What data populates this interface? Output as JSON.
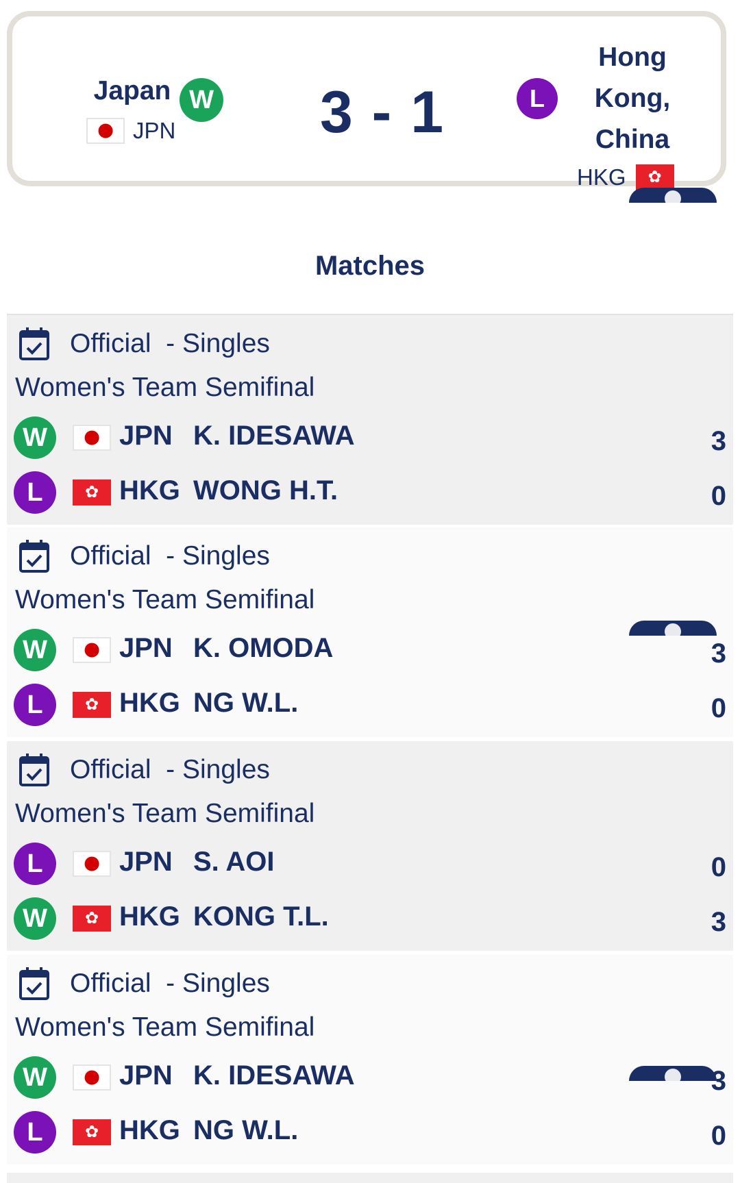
{
  "header": {
    "team_left": {
      "name": "Japan",
      "code": "JPN",
      "result": "W",
      "flag": "jpn"
    },
    "score": "3 - 1",
    "team_right": {
      "name_lines": [
        "Hong",
        "Kong,",
        "China"
      ],
      "code": "HKG",
      "result": "L",
      "flag": "hkg"
    }
  },
  "section_title": "Matches",
  "matches": [
    {
      "status": "Official",
      "type": "- Singles",
      "round": "Women's Team Semifinal",
      "players": [
        {
          "result": "W",
          "code": "JPN",
          "name": "K. IDESAWA",
          "score": "3"
        },
        {
          "result": "L",
          "code": "HKG",
          "name": "WONG H.T.",
          "score": "0"
        }
      ]
    },
    {
      "status": "Official",
      "type": "- Singles",
      "round": "Women's Team Semifinal",
      "players": [
        {
          "result": "W",
          "code": "JPN",
          "name": "K. OMODA",
          "score": "3"
        },
        {
          "result": "L",
          "code": "HKG",
          "name": "NG W.L.",
          "score": "0"
        }
      ]
    },
    {
      "status": "Official",
      "type": "- Singles",
      "round": "Women's Team Semifinal",
      "players": [
        {
          "result": "L",
          "code": "JPN",
          "name": "S. AOI",
          "score": "0"
        },
        {
          "result": "W",
          "code": "HKG",
          "name": "KONG T.L.",
          "score": "3"
        }
      ]
    },
    {
      "status": "Official",
      "type": "- Singles",
      "round": "Women's Team Semifinal",
      "players": [
        {
          "result": "W",
          "code": "JPN",
          "name": "K. IDESAWA",
          "score": "3"
        },
        {
          "result": "L",
          "code": "HKG",
          "name": "NG W.L.",
          "score": "0"
        }
      ]
    }
  ],
  "icons": {
    "calendar": "calendar-check-icon",
    "hkg_flag_glyph": "✿"
  },
  "colors": {
    "navy": "#1a2e63",
    "win_green": "#1aa45a",
    "loss_purple": "#7a12b8",
    "hk_red": "#e8202a",
    "jp_red": "#d40000"
  }
}
